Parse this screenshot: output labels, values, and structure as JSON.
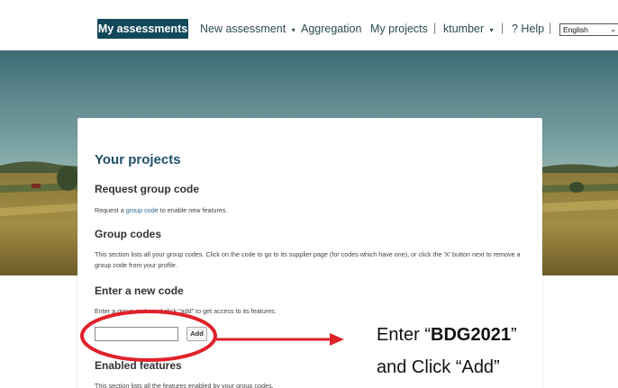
{
  "nav": {
    "active": "My assessments",
    "new_assessment": "New assessment",
    "new_assessment_caret": "▾",
    "aggregation": "Aggregation",
    "my_projects": "My projects",
    "user": "ktumber",
    "user_caret": "▾",
    "help": "? Help",
    "language": "English",
    "separator": "|",
    "colors": {
      "active_bg": "#12485a",
      "text": "#2d4a52"
    }
  },
  "card": {
    "title": "Your projects",
    "request": {
      "heading": "Request group code",
      "text_prefix": "Request a ",
      "link": "group code",
      "text_suffix": " to enable new features."
    },
    "group_codes": {
      "heading": "Group codes",
      "text": "This section lists all your group codes. Click on the code to go to its supplier page (for codes which have one), or click the 'X' button next to remove a group code from your profile."
    },
    "new_code": {
      "heading": "Enter a new code",
      "text": "Enter a group code and click \"add\" to get access to its features.",
      "input_value": "",
      "add_label": "Add"
    },
    "enabled": {
      "heading": "Enabled features",
      "text": "This section lists all the features enabled by your group codes."
    }
  },
  "annotation": {
    "line1_prefix": "Enter “",
    "line1_code": "BDG2021",
    "line1_suffix": "”",
    "line2": "and Click “Add”",
    "color": "#e0212a"
  }
}
